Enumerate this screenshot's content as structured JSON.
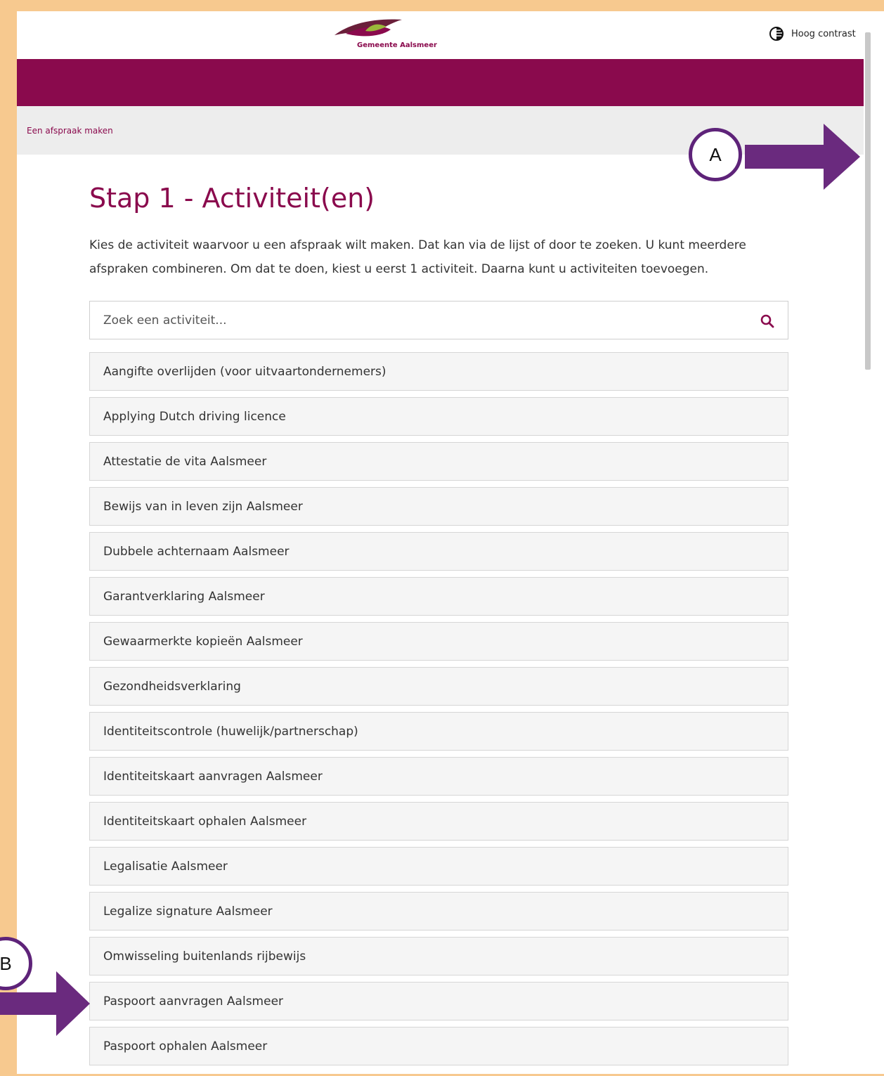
{
  "header": {
    "logo_text": "Gemeente Aalsmeer",
    "contrast_label": "Hoog contrast"
  },
  "breadcrumb": "Een afspraak maken",
  "page_title": "Stap 1 - Activiteit(en)",
  "intro": "Kies de activiteit waarvoor u een afspraak wilt maken. Dat kan via de lijst of door te zoeken. U kunt meerdere afspraken combineren. Om dat te doen, kiest u eerst 1 activiteit. Daarna kunt u activiteiten toevoegen.",
  "search": {
    "placeholder": "Zoek een activiteit...",
    "value": ""
  },
  "activities": [
    "Aangifte overlijden (voor uitvaartondernemers)",
    "Applying Dutch driving licence",
    "Attestatie de vita Aalsmeer",
    "Bewijs van in leven zijn Aalsmeer",
    "Dubbele achternaam Aalsmeer",
    "Garantverklaring Aalsmeer",
    "Gewaarmerkte kopieën Aalsmeer",
    "Gezondheidsverklaring",
    "Identiteitscontrole (huwelijk/partnerschap)",
    "Identiteitskaart aanvragen Aalsmeer",
    "Identiteitskaart ophalen Aalsmeer",
    "Legalisatie Aalsmeer",
    "Legalize signature Aalsmeer",
    "Omwisseling buitenlands rijbewijs",
    "Paspoort aanvragen Aalsmeer",
    "Paspoort ophalen Aalsmeer"
  ],
  "annotations": {
    "a": "A",
    "b": "B"
  },
  "colors": {
    "brand": "#8a0a4d",
    "annotation": "#5e2379",
    "border": "#f7c98f"
  },
  "icons": {
    "contrast": "contrast-icon",
    "search": "search-icon"
  }
}
